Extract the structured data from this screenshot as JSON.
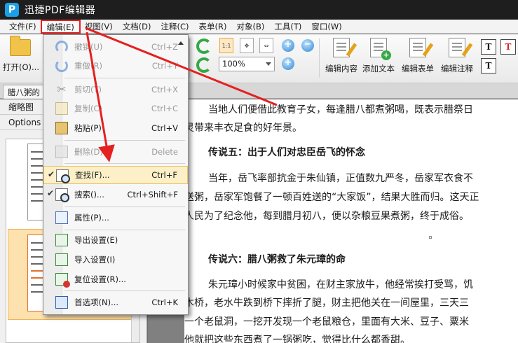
{
  "app": {
    "logo_letter": "P",
    "title": "迅捷PDF编辑器"
  },
  "menubar": [
    {
      "id": "file",
      "label": "文件(F)"
    },
    {
      "id": "edit",
      "label": "编辑(E)"
    },
    {
      "id": "view",
      "label": "视图(V)"
    },
    {
      "id": "document",
      "label": "文档(D)"
    },
    {
      "id": "comment",
      "label": "注释(C)"
    },
    {
      "id": "form",
      "label": "表单(R)"
    },
    {
      "id": "object",
      "label": "对象(B)"
    },
    {
      "id": "tools",
      "label": "工具(T)"
    },
    {
      "id": "window",
      "label": "窗口(W)"
    }
  ],
  "toolbar": {
    "open_label": "打开(O)...",
    "zoom_value": "100%",
    "zoom_in": "+",
    "zoom_out": "−",
    "view_actual": "1:1",
    "tools": [
      {
        "id": "edit-content",
        "label": "编辑内容"
      },
      {
        "id": "add-text",
        "label": "添加文本"
      },
      {
        "id": "edit-form",
        "label": "编辑表单"
      },
      {
        "id": "edit-annotation",
        "label": "编辑注释"
      }
    ],
    "text_tools": [
      "T",
      "T",
      "T"
    ]
  },
  "tab": {
    "label": "腊八粥的"
  },
  "left_panel": {
    "header": "缩略图",
    "options": "Options"
  },
  "edit_menu": [
    {
      "id": "undo",
      "label": "撤销(U)",
      "shortcut": "Ctrl+Z",
      "disabled": true
    },
    {
      "id": "redo",
      "label": "重做(R)",
      "shortcut": "Ctrl+Y",
      "disabled": true
    },
    {
      "id": "cut",
      "label": "剪切(T)",
      "shortcut": "Ctrl+X",
      "disabled": true
    },
    {
      "id": "copy",
      "label": "复制(C)",
      "shortcut": "Ctrl+C",
      "disabled": true
    },
    {
      "id": "paste",
      "label": "粘贴(P)",
      "shortcut": "Ctrl+V",
      "disabled": false
    },
    {
      "id": "delete",
      "label": "删除(D)",
      "shortcut": "Delete",
      "disabled": true
    },
    {
      "id": "find",
      "label": "查找(F)...",
      "shortcut": "Ctrl+F",
      "disabled": false,
      "checked": true,
      "highlighted": true
    },
    {
      "id": "search",
      "label": "搜索()...",
      "shortcut": "Ctrl+Shift+F",
      "disabled": false,
      "checked": true
    },
    {
      "id": "properties",
      "label": "属性(P)...",
      "shortcut": "",
      "disabled": false
    },
    {
      "id": "export-settings",
      "label": "导出设置(E)",
      "shortcut": "",
      "disabled": false
    },
    {
      "id": "import-settings",
      "label": "导入设置(I)",
      "shortcut": "",
      "disabled": false
    },
    {
      "id": "reset-settings",
      "label": "复位设置(R)...",
      "shortcut": "",
      "disabled": false
    },
    {
      "id": "preferences",
      "label": "首选项(N)...",
      "shortcut": "Ctrl+K",
      "disabled": false
    }
  ],
  "document": {
    "lines": [
      "当地人们便借此教育子女，每逢腊八都煮粥喝，既表示腊祭日",
      "灵带来丰衣足食的好年景。",
      "传说五：出于人们对忠臣岳飞的怀念",
      "当年，岳飞率部抗金于朱仙镇，正值数九严冬，岳家军衣食不",
      "送粥，岳家军饱餐了一顿百姓送的“大家饭”，结果大胜而归。这天正",
      "人民为了纪念他，每到腊月初八，便以杂粮豆果煮粥，终于成俗。",
      "传说六：腊八粥救了朱元璋的命",
      "朱元璋小时候家中贫困，在财主家放牛，他经常挨打受骂，饥",
      "木桥，老水牛跌到桥下摔折了腿，财主把他关在一间屋里，三天三",
      "一个老鼠洞，一挖开发现一个老鼠粮仓，里面有大米、豆子、粟米",
      "他就把这些东西煮了一锅粥吃，觉得比什么都香甜。"
    ]
  },
  "colors": {
    "annotation": "#e52020",
    "highlight": "#fdf0c8",
    "title_bar": "#1e1e1e"
  }
}
